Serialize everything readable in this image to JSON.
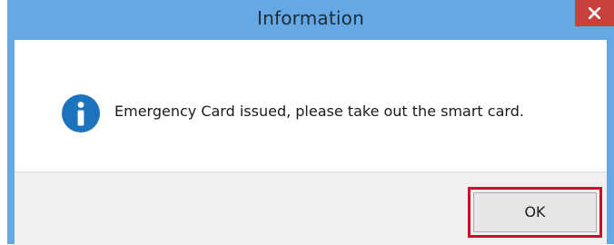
{
  "dialog": {
    "title": "Information",
    "close_icon": "close-icon",
    "message_icon": "information-icon",
    "message": "Emergency Card issued, please take out the smart card.",
    "ok_label": "OK"
  },
  "colors": {
    "titlebar": "#66a8e3",
    "close_button": "#c8413c",
    "highlight": "#c8102e",
    "info_icon": "#1e73be"
  }
}
